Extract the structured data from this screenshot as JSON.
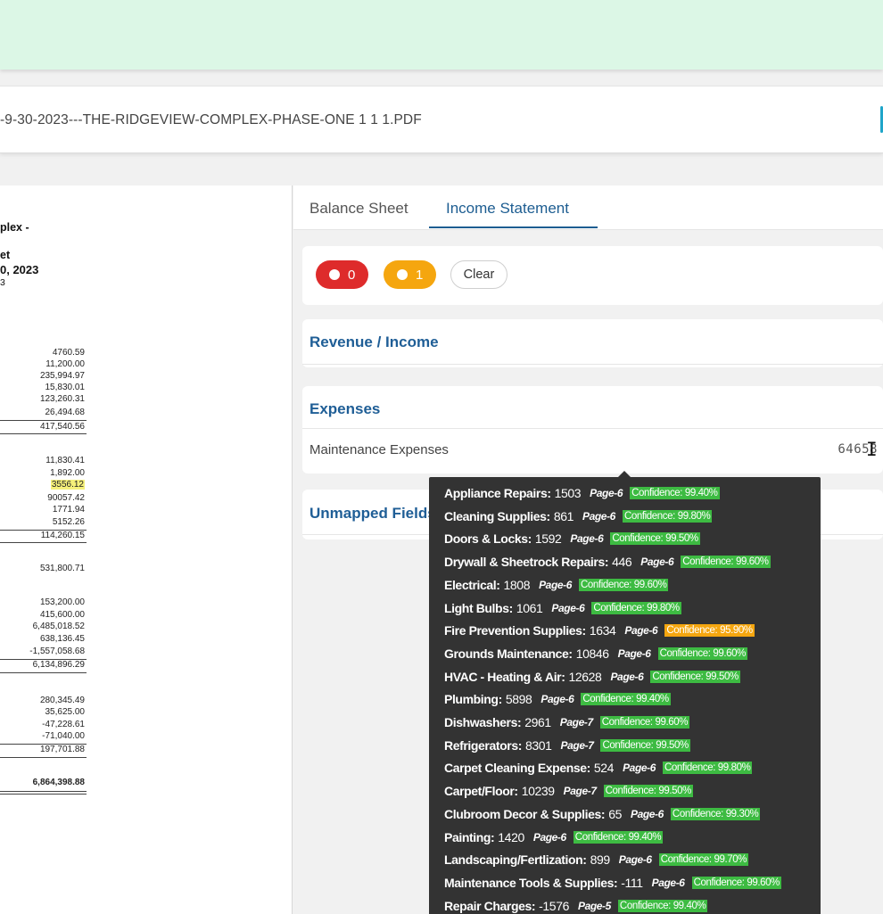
{
  "file_bar": {
    "file_name": "-9-30-2023---THE-RIDGEVIEW-COMPLEX-PHASE-ONE 1 1 1.PDF"
  },
  "document": {
    "heading_lines": [
      "plex -",
      "et",
      "0, 2023",
      "3"
    ],
    "section_a": [
      "4760.59",
      "11,200.00",
      "235,994.97",
      "15,830.01",
      "123,260.31",
      "26,494.68"
    ],
    "section_a_total": "417,540.56",
    "section_b": [
      "11,830.41",
      "1,892.00",
      "3556.12",
      "90057.42",
      "1771.94",
      "5152.26"
    ],
    "section_b_total": "114,260.15",
    "single_total": "531,800.71",
    "section_c": [
      "153,200.00",
      "415,600.00",
      "6,485,018.52",
      "638,136.45",
      "-1,557,058.68"
    ],
    "section_c_total": "6,134,896.29",
    "section_d": [
      "280,345.49",
      "35,625.00",
      "-47,228.61",
      "-71,040.00"
    ],
    "section_d_total": "197,701.88",
    "grand_total": "6,864,398.88",
    "highlight_color": "#f5f07a"
  },
  "tabs": [
    {
      "label": "Balance Sheet",
      "active": false
    },
    {
      "label": "Income Statement",
      "active": true
    }
  ],
  "filters": {
    "red_count": "0",
    "orange_count": "1",
    "clear_label": "Clear",
    "red_color": "#de2b2b",
    "orange_color": "#f5a60f"
  },
  "sections": {
    "revenue": {
      "title": "Revenue / Income"
    },
    "expenses": {
      "title": "Expenses",
      "rows": [
        {
          "label": "Maintenance Expenses",
          "value": "64658"
        }
      ]
    },
    "unmapped": {
      "title": "Unmapped Fields"
    }
  },
  "tooltip": {
    "items": [
      {
        "name": "Appliance Repairs:",
        "value": "1503",
        "page": "Page-6",
        "confidence": "Confidence: 99.40%",
        "status": "ok"
      },
      {
        "name": "Cleaning Supplies:",
        "value": "861",
        "page": "Page-6",
        "confidence": "Confidence: 99.80%",
        "status": "ok"
      },
      {
        "name": "Doors & Locks:",
        "value": "1592",
        "page": "Page-6",
        "confidence": "Confidence: 99.50%",
        "status": "ok"
      },
      {
        "name": "Drywall & Sheetrock Repairs:",
        "value": "446",
        "page": "Page-6",
        "confidence": "Confidence: 99.60%",
        "status": "ok"
      },
      {
        "name": "Electrical:",
        "value": "1808",
        "page": "Page-6",
        "confidence": "Confidence: 99.60%",
        "status": "ok"
      },
      {
        "name": "Light Bulbs:",
        "value": "1061",
        "page": "Page-6",
        "confidence": "Confidence: 99.80%",
        "status": "ok"
      },
      {
        "name": "Fire Prevention Supplies:",
        "value": "1634",
        "page": "Page-6",
        "confidence": "Confidence: 95.90%",
        "status": "warn"
      },
      {
        "name": "Grounds Maintenance:",
        "value": "10846",
        "page": "Page-6",
        "confidence": "Confidence: 99.60%",
        "status": "ok"
      },
      {
        "name": "HVAC - Heating & Air:",
        "value": "12628",
        "page": "Page-6",
        "confidence": "Confidence: 99.50%",
        "status": "ok"
      },
      {
        "name": "Plumbing:",
        "value": "5898",
        "page": "Page-6",
        "confidence": "Confidence: 99.40%",
        "status": "ok"
      },
      {
        "name": "Dishwashers:",
        "value": "2961",
        "page": "Page-7",
        "confidence": "Confidence: 99.60%",
        "status": "ok"
      },
      {
        "name": "Refrigerators:",
        "value": "8301",
        "page": "Page-7",
        "confidence": "Confidence: 99.50%",
        "status": "ok"
      },
      {
        "name": "Carpet Cleaning Expense:",
        "value": "524",
        "page": "Page-6",
        "confidence": "Confidence: 99.80%",
        "status": "ok"
      },
      {
        "name": "Carpet/Floor:",
        "value": "10239",
        "page": "Page-7",
        "confidence": "Confidence: 99.50%",
        "status": "ok"
      },
      {
        "name": "Clubroom Decor & Supplies:",
        "value": "65",
        "page": "Page-6",
        "confidence": "Confidence: 99.30%",
        "status": "ok"
      },
      {
        "name": "Painting:",
        "value": "1420",
        "page": "Page-6",
        "confidence": "Confidence: 99.40%",
        "status": "ok"
      },
      {
        "name": "Landscaping/Fertlization:",
        "value": "899",
        "page": "Page-6",
        "confidence": "Confidence: 99.70%",
        "status": "ok"
      },
      {
        "name": "Maintenance Tools & Supplies:",
        "value": "-111",
        "page": "Page-6",
        "confidence": "Confidence: 99.60%",
        "status": "ok"
      },
      {
        "name": "Repair Charges:",
        "value": "-1576",
        "page": "Page-5",
        "confidence": "Confidence: 99.40%",
        "status": "ok"
      }
    ],
    "ok_color": "#3dbb42",
    "warn_color": "#f5a60f"
  },
  "cursor": {
    "icon": "text-cursor-icon"
  }
}
